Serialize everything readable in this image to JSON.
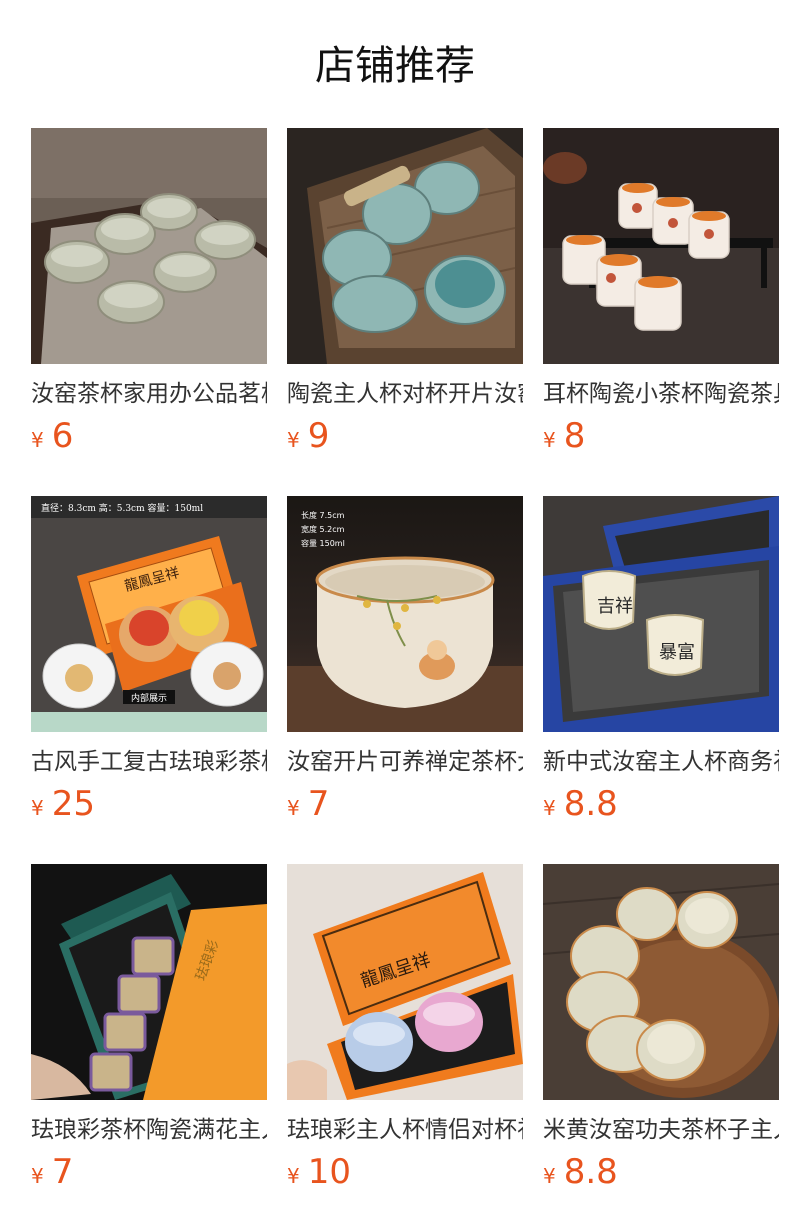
{
  "page": {
    "title": "店铺推荐"
  },
  "products": [
    {
      "name": "汝窑茶杯家用办公品茗杯",
      "currency": "¥",
      "price": "6"
    },
    {
      "name": "陶瓷主人杯对杯开片汝窑",
      "currency": "¥",
      "price": "9"
    },
    {
      "name": "耳杯陶瓷小茶杯陶瓷茶具",
      "currency": "¥",
      "price": "8"
    },
    {
      "name": "古风手工复古珐琅彩茶杯",
      "currency": "¥",
      "price": "25"
    },
    {
      "name": "汝窑开片可养禅定茶杯大",
      "currency": "¥",
      "price": "7"
    },
    {
      "name": "新中式汝窑主人杯商务礼",
      "currency": "¥",
      "price": "8.8"
    },
    {
      "name": "珐琅彩茶杯陶瓷满花主人",
      "currency": "¥",
      "price": "7"
    },
    {
      "name": "珐琅彩主人杯情侣对杯礼",
      "currency": "¥",
      "price": "10"
    },
    {
      "name": "米黄汝窑功夫茶杯子主人",
      "currency": "¥",
      "price": "8.8"
    }
  ],
  "image_labels": {
    "p4_spec": "直径：8.3cm   高：5.3cm   容量：150ml",
    "p4_inner": "内部展示",
    "p4_box_text": "龍鳳呈祥",
    "p5_len": "长度 7.5cm",
    "p5_wid": "宽度 5.2cm",
    "p5_cap": "容量 150ml",
    "p6_cup1": "吉祥",
    "p6_cup2": "暴富",
    "p8_box_text": "龍鳳呈祥",
    "p7_box_text": "珐琅彩"
  },
  "colors": {
    "price": "#e8541e",
    "text": "#333333"
  }
}
